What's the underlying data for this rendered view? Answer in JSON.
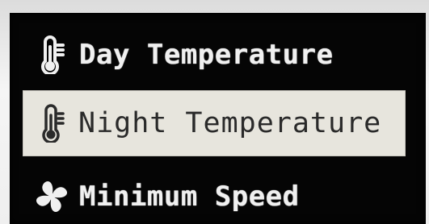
{
  "menu": {
    "items": [
      {
        "label": "Day Temperature",
        "icon": "thermometer-icon",
        "selected": false
      },
      {
        "label": "Night Temperature",
        "icon": "thermometer-icon",
        "selected": true
      },
      {
        "label": "Minimum Speed",
        "icon": "fan-icon",
        "selected": false
      }
    ]
  },
  "colors": {
    "screen_bg": "#050505",
    "text": "#f0f0f0",
    "selected_bg": "#e7e5dd",
    "selected_text": "#2a2a2a"
  }
}
